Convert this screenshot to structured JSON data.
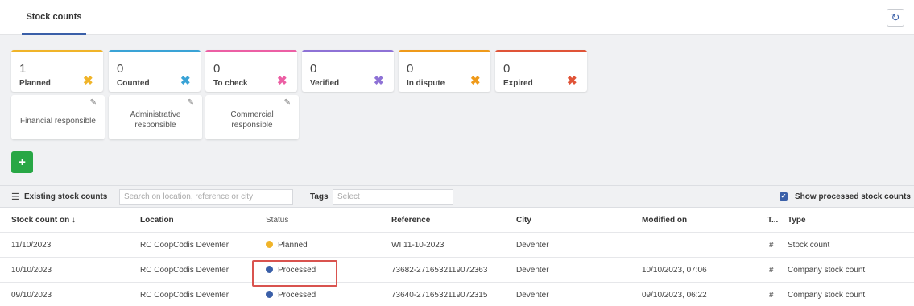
{
  "header": {
    "tab_label": "Stock counts",
    "refresh_icon": "refresh-icon"
  },
  "status_cards": [
    {
      "count": "1",
      "label": "Planned",
      "color": "#f0b429",
      "icon": "close-icon"
    },
    {
      "count": "0",
      "label": "Counted",
      "color": "#3aa3d6",
      "icon": "close-icon"
    },
    {
      "count": "0",
      "label": "To check",
      "color": "#ec5fa4",
      "icon": "close-icon"
    },
    {
      "count": "0",
      "label": "Verified",
      "color": "#8e72d6",
      "icon": "close-icon"
    },
    {
      "count": "0",
      "label": "In dispute",
      "color": "#ef9a1a",
      "icon": "close-icon"
    },
    {
      "count": "0",
      "label": "Expired",
      "color": "#e05438",
      "icon": "close-icon"
    }
  ],
  "responsible_cards": [
    {
      "label_line1": "Financial responsible",
      "label_line2": ""
    },
    {
      "label_line1": "Administrative",
      "label_line2": "responsible"
    },
    {
      "label_line1": "Commercial",
      "label_line2": "responsible"
    }
  ],
  "add_button": {
    "label": "+"
  },
  "filters": {
    "title": "Existing stock counts",
    "search_placeholder": "Search on location, reference or city",
    "tags_label": "Tags",
    "tags_placeholder": "Select",
    "show_processed_label": "Show processed stock counts",
    "show_processed_checked": true
  },
  "table": {
    "columns": {
      "stock_count_on": "Stock count on ↓",
      "location": "Location",
      "status": "Status",
      "reference": "Reference",
      "city": "City",
      "modified_on": "Modified on",
      "t": "T...",
      "type": "Type"
    },
    "rows": [
      {
        "date": "11/10/2023",
        "location": "RC CoopCodis Deventer",
        "status": "Planned",
        "status_color": "#f0b429",
        "reference": "WI 11-10-2023",
        "city": "Deventer",
        "modified_on": "",
        "t": "#",
        "type": "Stock count"
      },
      {
        "date": "10/10/2023",
        "location": "RC CoopCodis Deventer",
        "status": "Processed",
        "status_color": "#3a5fa8",
        "reference": "73682-2716532119072363",
        "city": "Deventer",
        "modified_on": "10/10/2023, 07:06",
        "t": "#",
        "type": "Company stock count"
      },
      {
        "date": "09/10/2023",
        "location": "RC CoopCodis Deventer",
        "status": "Processed",
        "status_color": "#3a5fa8",
        "reference": "73640-2716532119072315",
        "city": "Deventer",
        "modified_on": "09/10/2023, 06:22",
        "t": "#",
        "type": "Company stock count"
      }
    ]
  }
}
